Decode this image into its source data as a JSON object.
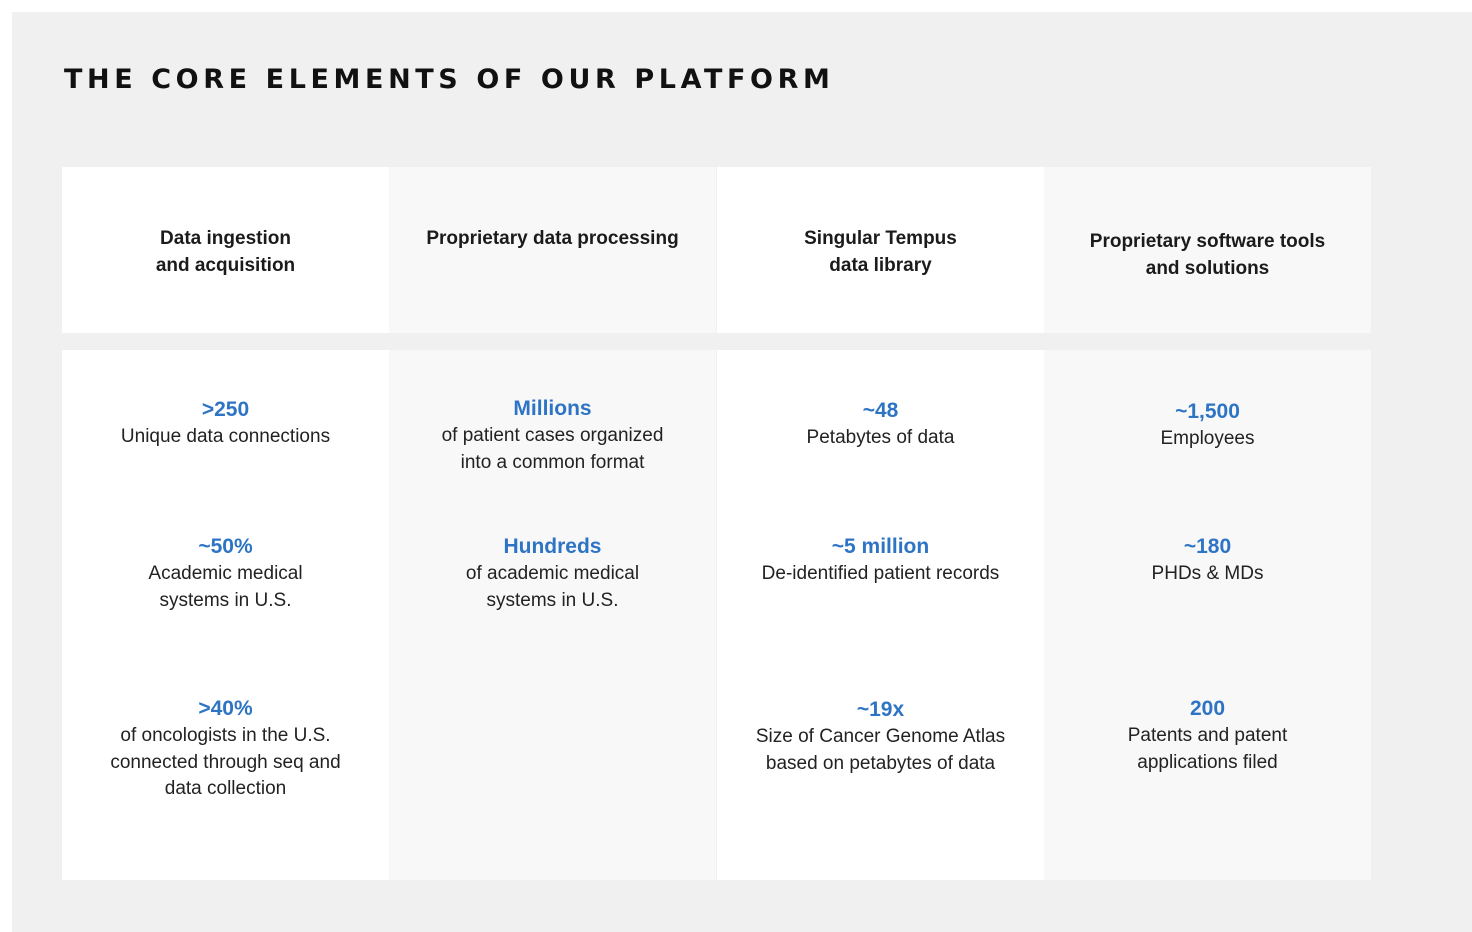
{
  "title": "THE CORE ELEMENTS OF OUR PLATFORM",
  "columns": [
    {
      "heading": "Data ingestion\nand acquisition",
      "stats": [
        {
          "value": ">250",
          "label": "Unique data connections"
        },
        {
          "value": "~50%",
          "label": "Academic medical\nsystems in U.S."
        },
        {
          "value": ">40%",
          "label": "of oncologists in the U.S.\nconnected through seq and\ndata collection"
        }
      ]
    },
    {
      "heading": "Proprietary data processing",
      "stats": [
        {
          "value": "Millions",
          "label": "of patient cases organized\ninto a common format"
        },
        {
          "value": "Hundreds",
          "label": "of academic medical\nsystems in U.S."
        }
      ]
    },
    {
      "heading": "Singular Tempus\ndata library",
      "stats": [
        {
          "value": "~48",
          "label": "Petabytes of data"
        },
        {
          "value": "~5 million",
          "label": "De-identified patient records"
        },
        {
          "value": "~19x",
          "label": "Size of Cancer Genome Atlas\nbased on petabytes of data"
        }
      ]
    },
    {
      "heading": "Proprietary software tools\nand solutions",
      "stats": [
        {
          "value": "~1,500",
          "label": "Employees"
        },
        {
          "value": "~180",
          "label": "PHDs & MDs"
        },
        {
          "value": "200",
          "label": "Patents and patent\napplications filed"
        }
      ]
    }
  ]
}
